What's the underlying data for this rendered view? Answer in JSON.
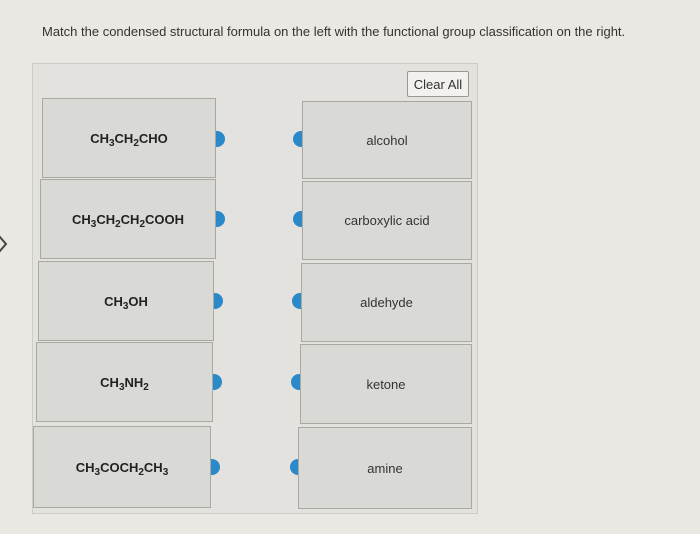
{
  "instruction": "Match the condensed structural formula on the left with the functional group classification on the right.",
  "clear_button_label": "Clear All",
  "left_items": [
    {
      "parts": [
        [
          "CH",
          "3"
        ],
        [
          "CH",
          "2"
        ],
        [
          "CHO",
          ""
        ]
      ]
    },
    {
      "parts": [
        [
          "CH",
          "3"
        ],
        [
          "CH",
          "2"
        ],
        [
          "CH",
          "2"
        ],
        [
          "COOH",
          ""
        ]
      ]
    },
    {
      "parts": [
        [
          "CH",
          "3"
        ],
        [
          "OH",
          ""
        ]
      ]
    },
    {
      "parts": [
        [
          "CH",
          "3"
        ],
        [
          "NH",
          "2"
        ]
      ]
    },
    {
      "parts": [
        [
          "CH",
          "3"
        ],
        [
          "COCH",
          "2"
        ],
        [
          "CH",
          "3"
        ]
      ]
    }
  ],
  "right_items": [
    "alcohol",
    "carboxylic acid",
    "aldehyde",
    "ketone",
    "amine"
  ],
  "colors": {
    "connector": "#2c89c9",
    "card_bg": "#d9d9d6",
    "page_bg": "#ebe8e3"
  }
}
